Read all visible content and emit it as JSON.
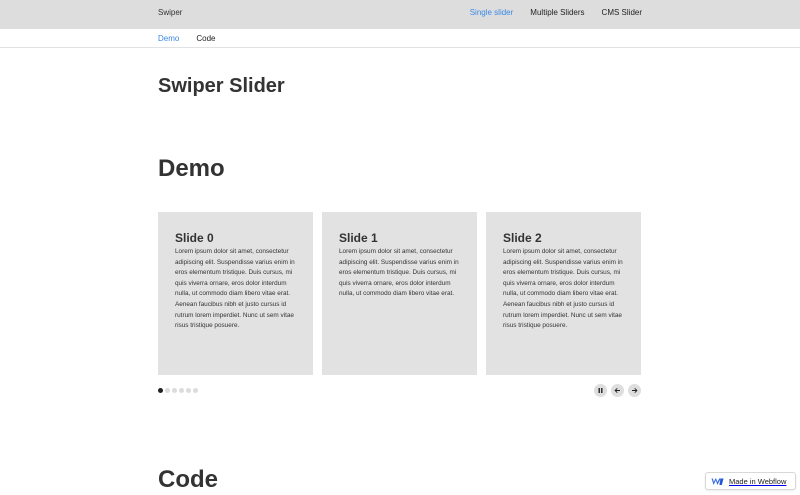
{
  "nav": {
    "brand": "Swiper",
    "links": [
      {
        "label": "Single slider"
      },
      {
        "label": "Multiple Sliders"
      },
      {
        "label": "CMS Slider"
      }
    ],
    "active_color": "#3b89e6"
  },
  "subnav": {
    "tabs": [
      {
        "label": "Demo"
      },
      {
        "label": "Code"
      }
    ]
  },
  "page_title": "Swiper Slider",
  "sections": {
    "demo": "Demo",
    "code": "Code"
  },
  "slides": [
    {
      "title": "Slide 0",
      "body": "Lorem ipsum dolor sit amet, consectetur adipiscing elit. Suspendisse varius enim in eros elementum tristique. Duis cursus, mi quis viverra ornare, eros dolor interdum nulla, ut commodo diam libero vitae erat. Aenean faucibus nibh et justo cursus id rutrum lorem imperdiet. Nunc ut sem vitae risus tristique posuere."
    },
    {
      "title": "Slide 1",
      "body": "Lorem ipsum dolor sit amet, consectetur adipiscing elit. Suspendisse varius enim in eros elementum tristique. Duis cursus, mi quis viverra ornare, eros dolor interdum nulla, ut commodo diam libero vitae erat."
    },
    {
      "title": "Slide 2",
      "body": "Lorem ipsum dolor sit amet, consectetur adipiscing elit. Suspendisse varius enim in eros elementum tristique. Duis cursus, mi quis viverra ornare, eros dolor interdum nulla, ut commodo diam libero vitae erat. Aenean faucibus nibh et justo cursus id rutrum lorem imperdiet. Nunc ut sem vitae risus tristique posuere."
    }
  ],
  "pagination": {
    "active_index": 0
  },
  "controls": [
    {
      "icon": "pause-icon"
    },
    {
      "icon": "arrow-left-icon"
    },
    {
      "icon": "arrow-right-icon"
    }
  ],
  "badge": {
    "label": "Made in Webflow",
    "icon": "webflow-logo-icon"
  }
}
